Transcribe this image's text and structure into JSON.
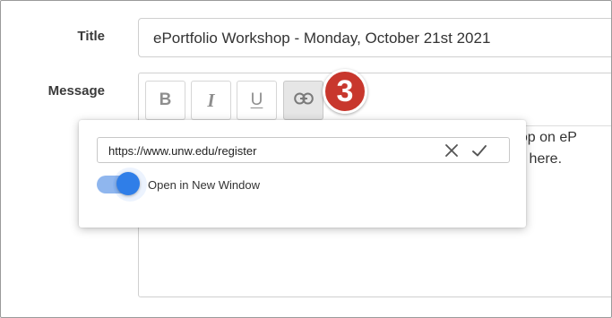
{
  "form": {
    "title_label": "Title",
    "title_value": "ePortfolio Workshop - Monday, October 21st 2021",
    "message_label": "Message"
  },
  "toolbar": {
    "bold_label": "B",
    "italic_label": "I",
    "underline_label": "U",
    "link_icon": "link-icon"
  },
  "editor": {
    "line1": "kshop on eP",
    "line2": "click here."
  },
  "step_badge": "3",
  "link_popup": {
    "url_value": "https://www.unw.edu/register",
    "cancel_icon": "close-icon",
    "confirm_icon": "check-icon",
    "new_window_label": "Open in New Window",
    "new_window_enabled": true
  },
  "colors": {
    "badge": "#c8372d",
    "toggle_on": "#2f7ee8",
    "toggle_track": "#8fb6ee"
  }
}
